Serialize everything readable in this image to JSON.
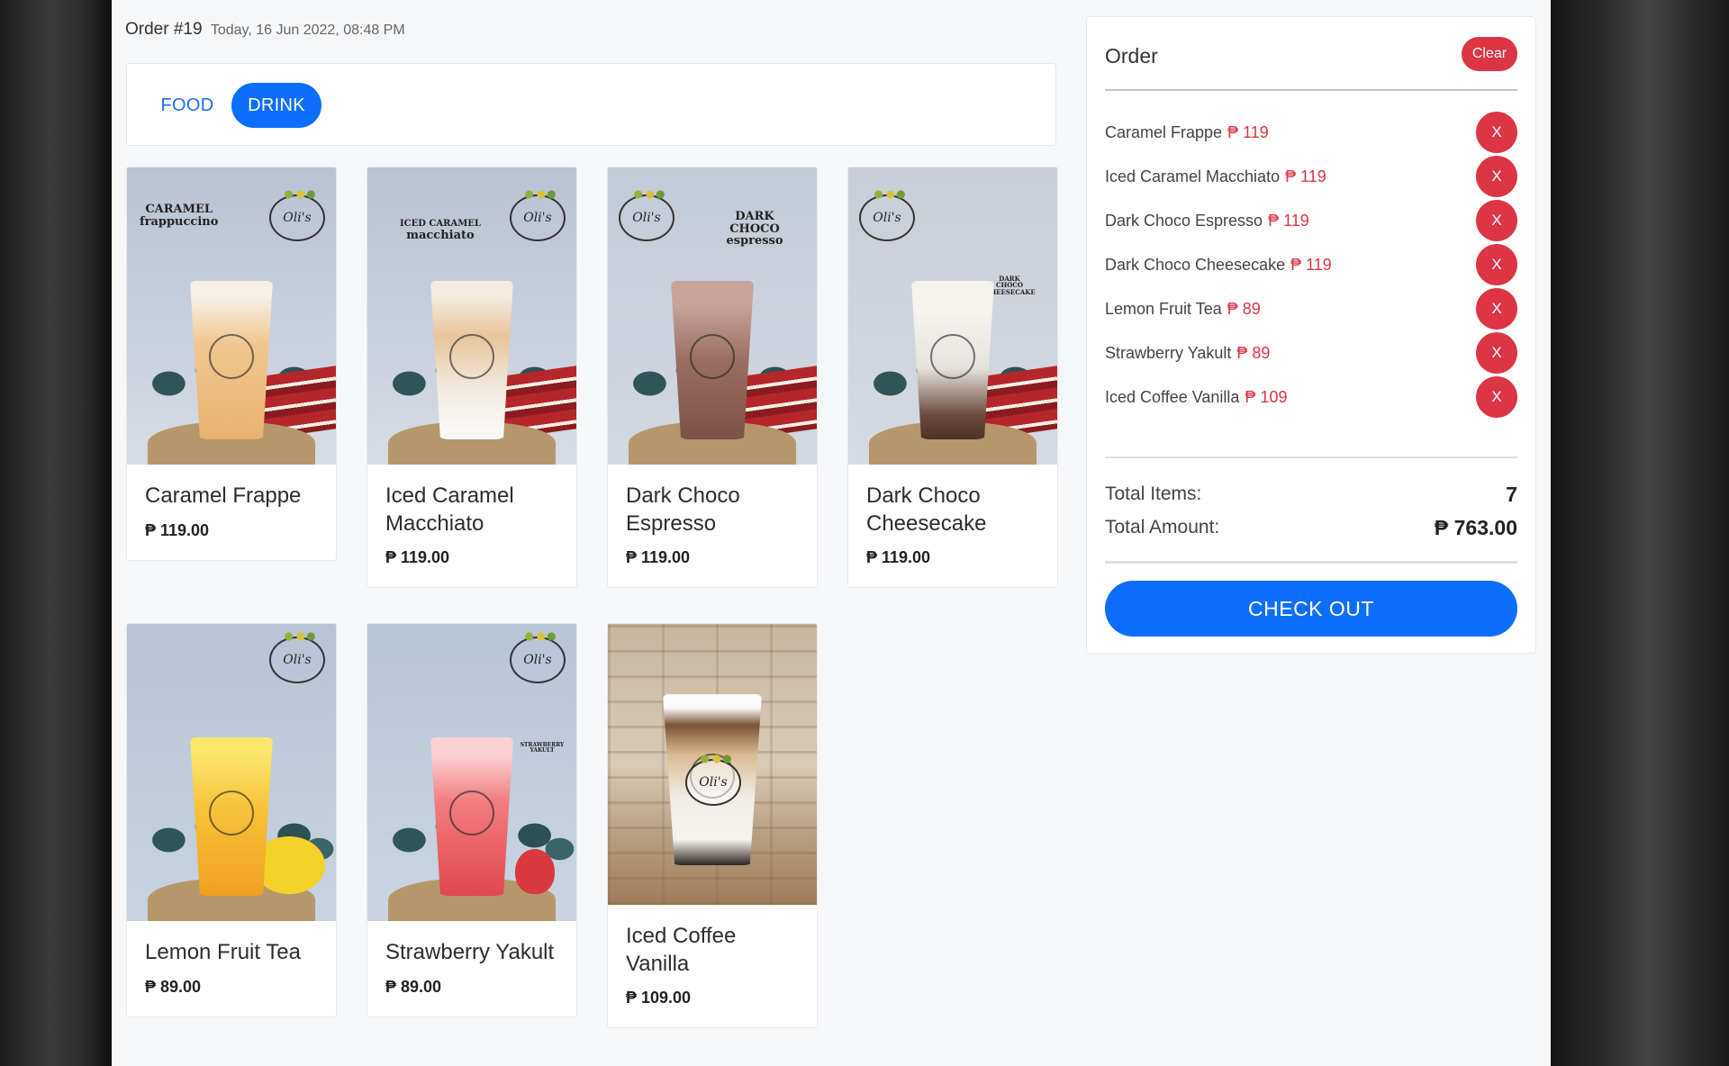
{
  "order": {
    "label": "Order #19",
    "datetime": "Today, 16 Jun 2022, 08:48 PM"
  },
  "tabs": [
    {
      "label": "FOOD",
      "active": false
    },
    {
      "label": "DRINK",
      "active": true
    }
  ],
  "products": [
    {
      "name": "Caramel Frappe",
      "price": "₱ 119.00",
      "promo": "CARAMEL",
      "promo_script": "frappuccino",
      "logo": "Oli's",
      "drink_color": "#f0c690"
    },
    {
      "name": "Iced Caramel Macchiato",
      "price": "₱ 119.00",
      "promo": "ICED CARAMEL",
      "promo_script": "macchiato",
      "logo": "Oli's",
      "drink_color": "#e8c49a"
    },
    {
      "name": "Dark Choco Espresso",
      "price": "₱ 119.00",
      "promo": "DARK CHOCO",
      "promo_script": "espresso",
      "logo": "Oli's",
      "drink_color": "#9a6e62"
    },
    {
      "name": "Dark Choco Cheesecake",
      "price": "₱ 119.00",
      "promo": "DARK CHOCO CHEESECAKE",
      "promo_script": "",
      "logo": "Oli's",
      "drink_color": "#e6e2de"
    },
    {
      "name": "Lemon Fruit Tea",
      "price": "₱ 89.00",
      "promo": "",
      "promo_script": "",
      "logo": "Oli's",
      "drink_color": "#f3a92a"
    },
    {
      "name": "Strawberry Yakult",
      "price": "₱ 89.00",
      "promo": "STRAWBERRY YAKULT",
      "promo_script": "",
      "logo": "Oli's",
      "drink_color": "#ef6a6e"
    },
    {
      "name": "Iced Coffee Vanilla",
      "price": "₱ 109.00",
      "promo": "",
      "promo_script": "",
      "logo": "Oli's",
      "drink_color": "#d9b98f"
    }
  ],
  "cart": {
    "title": "Order",
    "clear_label": "Clear",
    "remove_label": "X",
    "items": [
      {
        "name": "Caramel Frappe",
        "price": "₱ 119"
      },
      {
        "name": "Iced Caramel Macchiato",
        "price": "₱ 119"
      },
      {
        "name": "Dark Choco Espresso",
        "price": "₱ 119"
      },
      {
        "name": "Dark Choco Cheesecake",
        "price": "₱ 119"
      },
      {
        "name": "Lemon Fruit Tea",
        "price": "₱ 89"
      },
      {
        "name": "Strawberry Yakult",
        "price": "₱ 89"
      },
      {
        "name": "Iced Coffee Vanilla",
        "price": "₱ 109"
      }
    ],
    "total_items_label": "Total Items:",
    "total_items_value": "7",
    "total_amount_label": "Total Amount:",
    "total_amount_value": "₱ 763.00",
    "checkout_label": "CHECK OUT"
  },
  "colors": {
    "primary": "#0d6efd",
    "danger": "#dc3545",
    "page_bg": "#f6f7f9"
  }
}
